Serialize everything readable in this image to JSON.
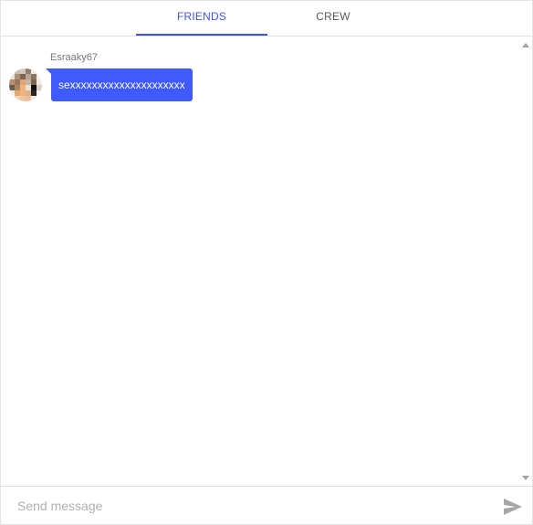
{
  "tabs": {
    "friends_label": "FRIENDS",
    "crew_label": "CREW",
    "active": "FRIENDS"
  },
  "messages": [
    {
      "username": "Esraaky67",
      "text": "sexxxxxxxxxxxxxxxxxxxxx"
    }
  ],
  "composer": {
    "placeholder": "Send message",
    "send_icon": "send-icon"
  },
  "colors": {
    "accent": "#3f51f5",
    "bubble": "#3f5afe",
    "tab_inactive": "#5a5a5a"
  }
}
